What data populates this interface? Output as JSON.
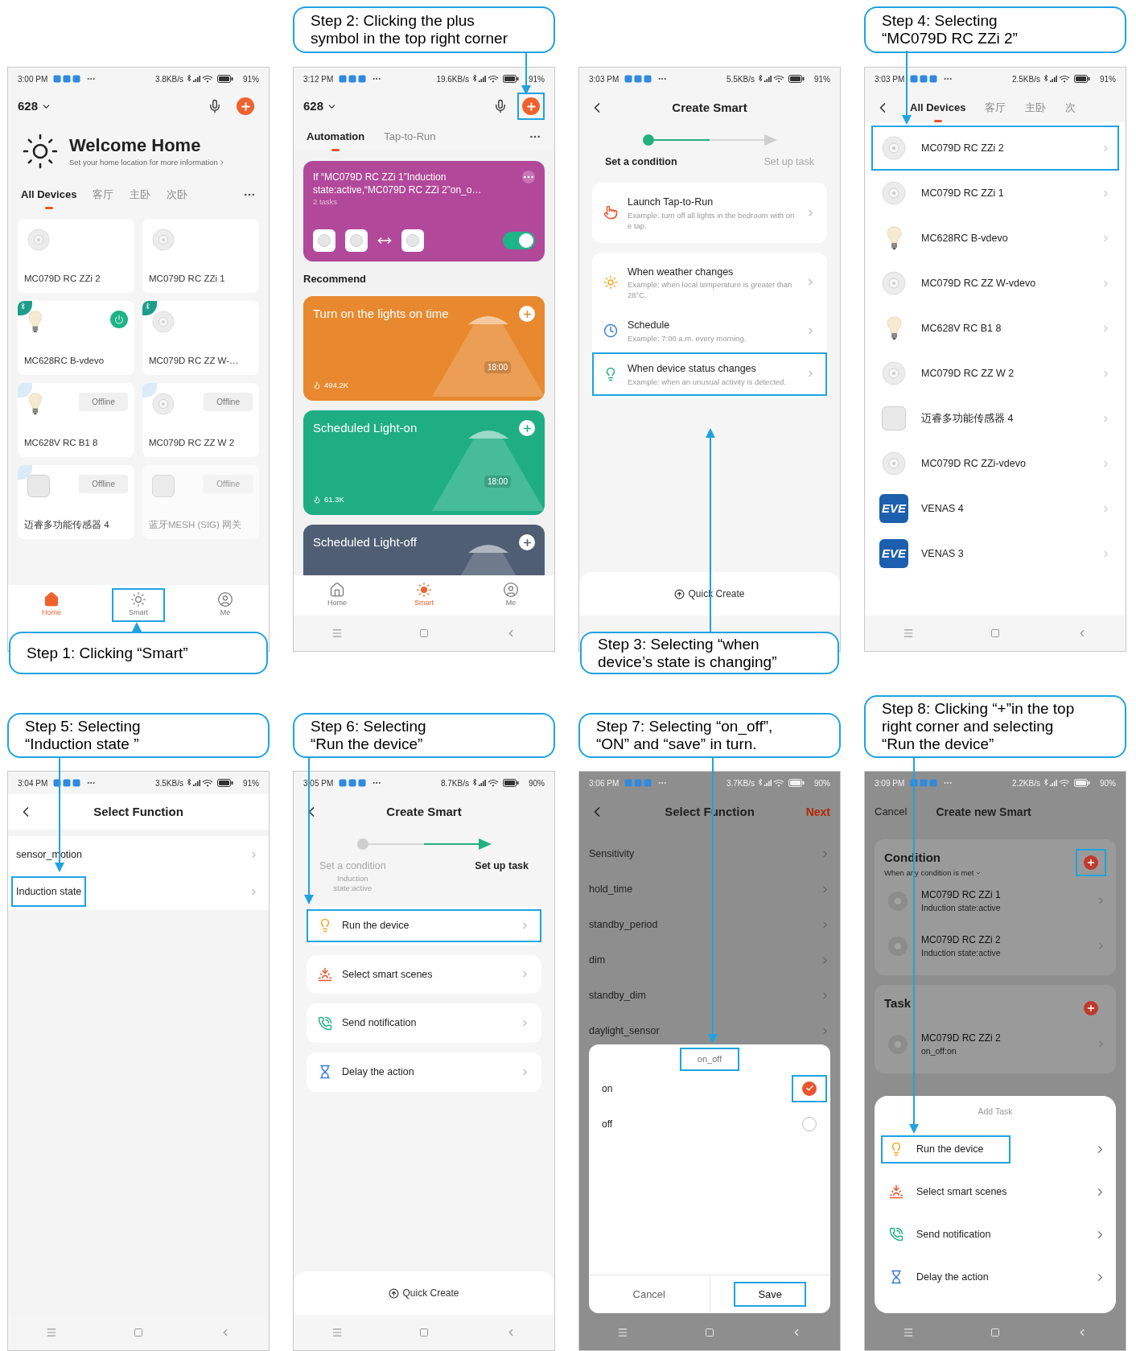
{
  "screens": [
    {
      "kind": "home",
      "callout": [
        "Step 1: Clicking “Smart”"
      ],
      "status": {
        "time": "3:00 PM",
        "speed": "3.8KB/s",
        "battery": "91%"
      },
      "home": "628",
      "title": "Welcome Home",
      "subtitle": "Set your home location for more information",
      "rooms": [
        {
          "label": "All Devices",
          "selected": true
        },
        {
          "label": "客厅",
          "selected": false
        },
        {
          "label": "主卧",
          "selected": false
        },
        {
          "label": "次卧",
          "selected": false
        }
      ],
      "devices": [
        {
          "name": "MC079D RC ZZi 2",
          "kind": "sensor",
          "power": false,
          "disabled": false
        },
        {
          "name": "MC079D RC ZZi 1",
          "kind": "sensor",
          "power": false,
          "disabled": false
        },
        {
          "name": "MC628RC B-vdevo",
          "kind": "bulb",
          "bluetooth": true,
          "power": true,
          "disabled": false
        },
        {
          "name": "MC079D RC ZZ W-…",
          "kind": "sensor",
          "bluetooth": true,
          "power": false,
          "disabled": false
        },
        {
          "name": "MC628V RC B1 8",
          "kind": "bulb",
          "bluetooth": false,
          "status": "Offline",
          "power": false,
          "disabled": false
        },
        {
          "name": "MC079D RC ZZ W 2",
          "kind": "sensor",
          "bluetooth": false,
          "status": "Offline",
          "power": false,
          "disabled": false
        },
        {
          "name": "迈睿多功能传感器 4",
          "kind": "hub",
          "bluetooth": false,
          "status": "Offline",
          "power": false,
          "disabled": false
        },
        {
          "name": "蓝牙MESH (SIG) 网关",
          "kind": "hub",
          "status": "Offline",
          "power": false,
          "disabled": true
        }
      ],
      "nav": [
        {
          "label": "Home",
          "selected": true,
          "highlighted": false
        },
        {
          "label": "Smart",
          "selected": false,
          "highlighted": true
        },
        {
          "label": "Me",
          "selected": false,
          "highlighted": false
        }
      ]
    },
    {
      "kind": "smart",
      "callout": [
        "Step 2: Clicking the plus",
        "symbol in the top right corner"
      ],
      "status": {
        "time": "3:12 PM",
        "speed": "19.6KB/s",
        "battery": "91%"
      },
      "home": "628",
      "add_highlighted": true,
      "tabs": [
        {
          "label": "Automation",
          "selected": true
        },
        {
          "label": "Tap-to-Run",
          "selected": false
        }
      ],
      "automation": {
        "title": "If “MC079D RC ZZi 1”Induction state:active,“MC079D RC ZZi 2”on_o…",
        "subtitle": "2 tasks",
        "on": true
      },
      "section": "Recommend",
      "recommend": [
        {
          "title": "Turn on the lights on time",
          "clock": "18:00",
          "count": "494.2K",
          "color": "#e8892f"
        },
        {
          "title": "Scheduled Light-on",
          "clock": "18:00",
          "count": "61.3K",
          "color": "#1fae84"
        },
        {
          "title": "Scheduled Light-off",
          "color": "#4f5e73"
        }
      ],
      "nav": [
        {
          "label": "Home",
          "selected": false,
          "highlighted": false
        },
        {
          "label": "Smart",
          "selected": true,
          "highlighted": false
        },
        {
          "label": "Me",
          "selected": false,
          "highlighted": false
        }
      ]
    },
    {
      "kind": "create",
      "callout": [
        "Step 3: Selecting “when",
        "device’s state is changing”"
      ],
      "status": {
        "time": "3:03 PM",
        "speed": "5.5KB/s",
        "battery": "91%"
      },
      "title": "Create Smart",
      "steps": [
        {
          "label": "Set a condition",
          "selected": true
        },
        {
          "label": "Set up task",
          "selected": false
        }
      ],
      "groups": [
        [
          {
            "kind": "tap",
            "title": "Launch Tap-to-Run",
            "description": "Example: turn off all lights in the bedroom with one tap.",
            "highlighted": false
          }
        ],
        [
          {
            "kind": "weather",
            "title": "When weather changes",
            "description": "Example: when local temperature is greater than 28°C.",
            "highlighted": false
          },
          {
            "kind": "schedule",
            "title": "Schedule",
            "description": "Example: 7:00 a.m. every morning.",
            "highlighted": false
          },
          {
            "kind": "device",
            "title": "When device status changes",
            "description": "Example: when an unusual activity is detected.",
            "highlighted": true
          }
        ]
      ],
      "quick": "Quick Create"
    },
    {
      "kind": "device_list",
      "callout": [
        "Step 4: Selecting",
        "“MC079D RC ZZi 2”"
      ],
      "status": {
        "time": "3:03 PM",
        "speed": "2.5KB/s",
        "battery": "91%"
      },
      "rooms": [
        {
          "label": "All Devices",
          "selected": true
        },
        {
          "label": "客厅",
          "selected": false
        },
        {
          "label": "主卧",
          "selected": false
        },
        {
          "label": "次",
          "selected": false
        }
      ],
      "devices": [
        {
          "name": "MC079D RC ZZi 2",
          "kind": "sensor",
          "highlighted": true
        },
        {
          "name": "MC079D RC ZZi 1",
          "kind": "sensor",
          "highlighted": false
        },
        {
          "name": "MC628RC B-vdevo",
          "kind": "bulb",
          "highlighted": false
        },
        {
          "name": "MC079D RC ZZ W-vdevo",
          "kind": "sensor",
          "highlighted": false
        },
        {
          "name": "MC628V RC B1 8",
          "kind": "bulb",
          "highlighted": false
        },
        {
          "name": "MC079D RC ZZ W 2",
          "kind": "sensor",
          "highlighted": false
        },
        {
          "name": "迈睿多功能传感器 4",
          "kind": "hub",
          "highlighted": false
        },
        {
          "name": "MC079D RC ZZi-vdevo",
          "kind": "sensor",
          "highlighted": false
        },
        {
          "name": "VENAS 4",
          "kind": "logo",
          "logo": "EVE",
          "highlighted": false
        },
        {
          "name": "VENAS 3",
          "kind": "logo",
          "logo": "EVE",
          "highlighted": false
        }
      ]
    },
    {
      "kind": "function",
      "callout": [
        "Step 5: Selecting",
        "“Induction state ”"
      ],
      "status": {
        "time": "3:04 PM",
        "speed": "3.5KB/s",
        "battery": "91%"
      },
      "title": "Select Function",
      "items": [
        {
          "label": "sensor_motion",
          "highlighted": false
        },
        {
          "label": "Induction state",
          "highlighted": true
        }
      ]
    },
    {
      "kind": "create",
      "callout": [
        "Step 6: Selecting",
        "“Run the device”"
      ],
      "status": {
        "time": "3:05 PM",
        "speed": "8.7KB/s",
        "battery": "90%"
      },
      "title": "Create Smart",
      "steps": [
        {
          "label": "Set a condition",
          "selected": false,
          "detail": "Induction state:active"
        },
        {
          "label": "Set up task",
          "selected": true
        }
      ],
      "groups": [
        [
          {
            "kind": "run",
            "title": "Run the device",
            "highlighted": true
          }
        ],
        [
          {
            "kind": "scenes",
            "title": "Select smart scenes",
            "highlighted": false
          }
        ],
        [
          {
            "kind": "notify",
            "title": "Send notification",
            "highlighted": false
          }
        ],
        [
          {
            "kind": "delay",
            "title": "Delay the action",
            "highlighted": false
          }
        ]
      ],
      "quick": "Quick Create"
    },
    {
      "kind": "function_modal",
      "callout": [
        "Step 7: Selecting “on_off”,",
        "“ON” and “save” in turn."
      ],
      "status": {
        "time": "3:06 PM",
        "speed": "3.7KB/s",
        "battery": "90%"
      },
      "title": "Select Function",
      "next": "Next",
      "items": [
        {
          "label": "Sensitivity"
        },
        {
          "label": "hold_time"
        },
        {
          "label": "standby_period"
        },
        {
          "label": "dim"
        },
        {
          "label": "standby_dim"
        },
        {
          "label": "daylight_sensor"
        }
      ],
      "dialog": {
        "title": "on_off",
        "title_highlighted": true,
        "options": [
          {
            "label": "on",
            "selected": true,
            "highlighted": true
          },
          {
            "label": "off",
            "selected": false,
            "highlighted": false
          }
        ],
        "buttons": [
          {
            "label": "Cancel",
            "highlighted": false
          },
          {
            "label": "Save",
            "highlighted": true
          }
        ]
      }
    },
    {
      "kind": "new_smart",
      "callout": [
        "Step 8: Clicking “+”in the top",
        "right corner and selecting",
        "“Run the device”"
      ],
      "status": {
        "time": "3:09 PM",
        "speed": "2.2KB/s",
        "battery": "90%"
      },
      "cancel": "Cancel",
      "title": "Create new Smart",
      "sections": [
        {
          "title": "Condition",
          "subtitle": "When any condition is met",
          "add_highlighted": true,
          "entries": [
            {
              "name": "MC079D RC ZZi 1",
              "detail": "Induction state:active"
            },
            {
              "name": "MC079D RC ZZi 2",
              "detail": "Induction state:active"
            }
          ]
        },
        {
          "title": "Task",
          "add_highlighted": false,
          "entries": [
            {
              "name": "MC079D RC ZZi 2",
              "detail": "on_off:on"
            }
          ]
        }
      ],
      "sheet": {
        "title": "Add Task",
        "items": [
          {
            "kind": "run",
            "title": "Run the device",
            "highlighted": true
          },
          {
            "kind": "scenes",
            "title": "Select smart scenes",
            "highlighted": false
          },
          {
            "kind": "notify",
            "title": "Send notification",
            "highlighted": false
          },
          {
            "kind": "delay",
            "title": "Delay the action",
            "highlighted": false
          }
        ]
      }
    }
  ]
}
